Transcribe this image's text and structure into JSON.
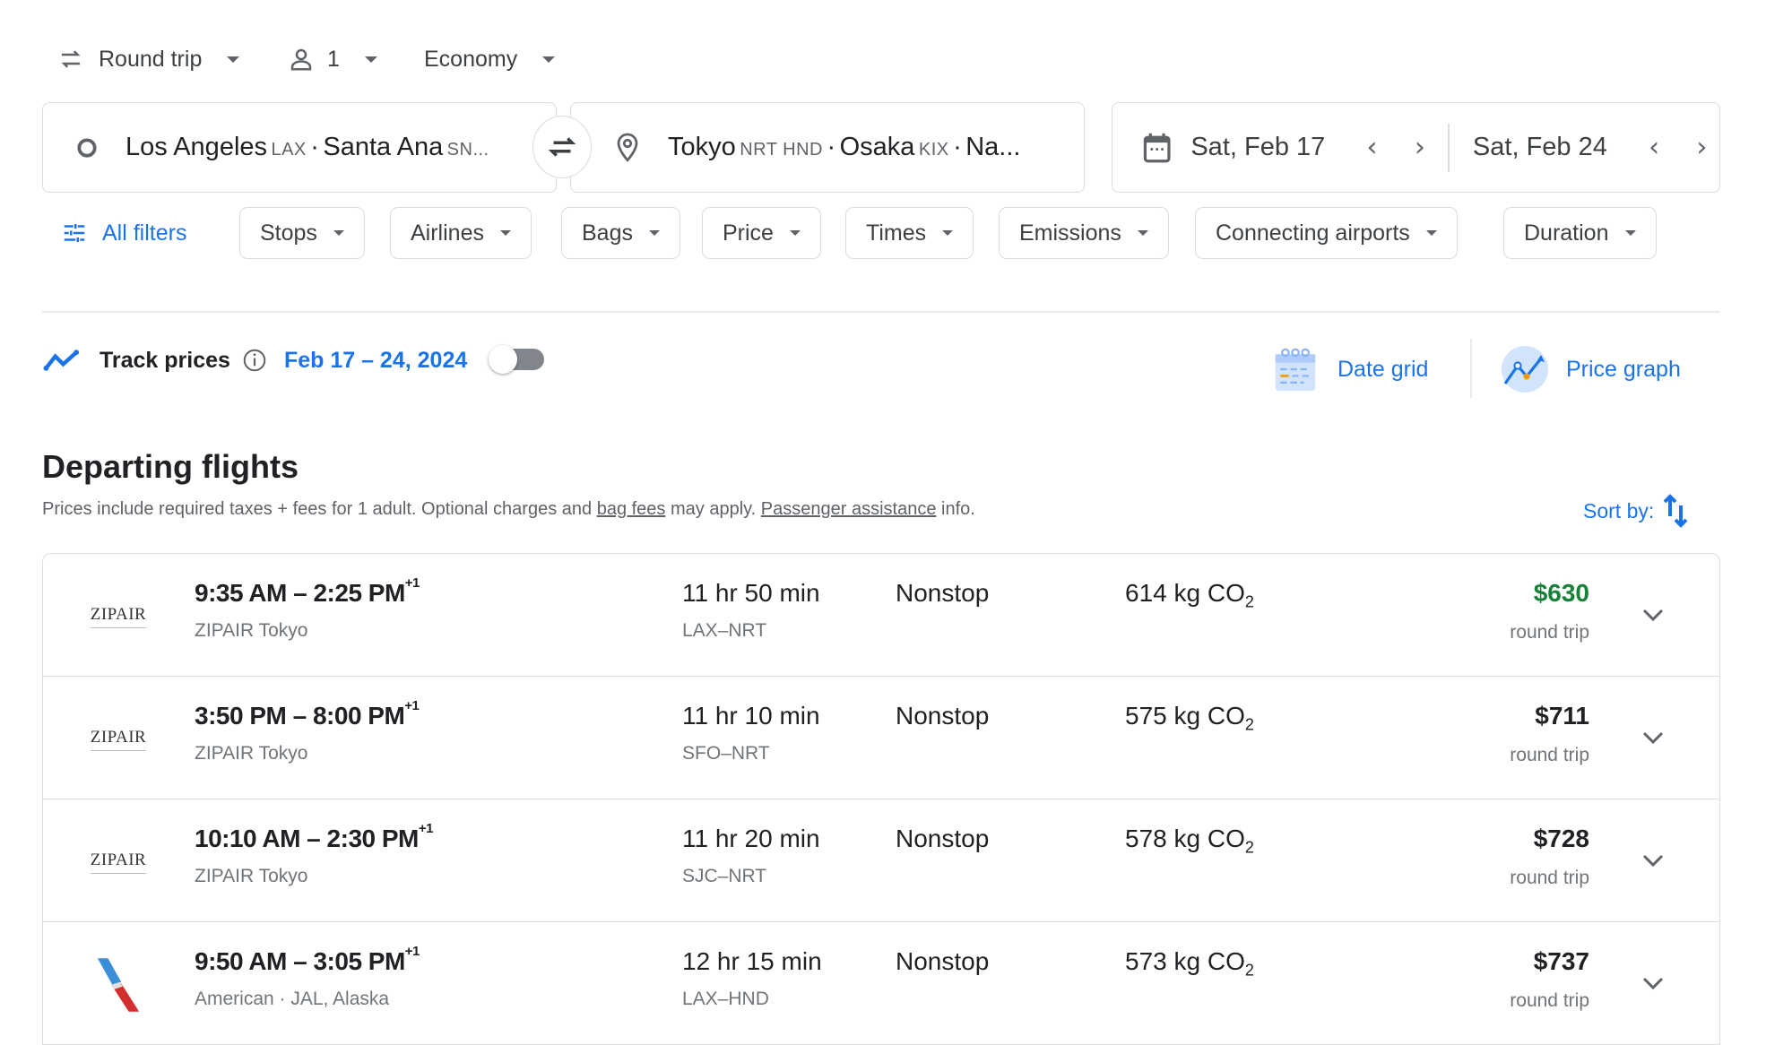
{
  "top_bar": {
    "trip_type": "Round trip",
    "passengers": "1",
    "cabin_class": "Economy"
  },
  "search": {
    "origin": {
      "city": "Los Angeles",
      "code": "LAX",
      "separator": "·",
      "city2": "Santa Ana",
      "code2": "SN..."
    },
    "destination": {
      "city": "Tokyo",
      "code": "NRT HND",
      "separator": "·",
      "city2": "Osaka",
      "code2": "KIX",
      "separator2": "·",
      "city3": "Na..."
    },
    "depart_date": "Sat, Feb 17",
    "return_date": "Sat, Feb 24"
  },
  "filters": {
    "all_filters": "All filters",
    "chips": [
      "Stops",
      "Airlines",
      "Bags",
      "Price",
      "Times",
      "Emissions",
      "Connecting airports",
      "Duration"
    ]
  },
  "track": {
    "label": "Track prices",
    "dates": "Feb 17 – 24, 2024",
    "toggle_on": false,
    "date_grid": "Date grid",
    "price_graph": "Price graph"
  },
  "section": {
    "title": "Departing flights",
    "note_pre": "Prices include required taxes + fees for 1 adult. Optional charges and ",
    "bag_fees_link": "bag fees",
    "note_mid": " may apply. ",
    "assistance_link": "Passenger assistance",
    "note_post": " info.",
    "sort_label": "Sort by:"
  },
  "colors": {
    "accent_blue": "#1a73e8",
    "cheapest_green": "#188038"
  },
  "flights": [
    {
      "logo": "ZIPAIR",
      "depart": "9:35 AM",
      "arrive": "2:25 PM",
      "day_offset": "+1",
      "airline": "ZIPAIR Tokyo",
      "duration": "11 hr 50 min",
      "route": "LAX–NRT",
      "stops": "Nonstop",
      "co2": "614 kg CO",
      "co2_sub": "2",
      "price": "$630",
      "price_type": "round trip",
      "cheapest": true
    },
    {
      "logo": "ZIPAIR",
      "depart": "3:50 PM",
      "arrive": "8:00 PM",
      "day_offset": "+1",
      "airline": "ZIPAIR Tokyo",
      "duration": "11 hr 10 min",
      "route": "SFO–NRT",
      "stops": "Nonstop",
      "co2": "575 kg CO",
      "co2_sub": "2",
      "price": "$711",
      "price_type": "round trip",
      "cheapest": false
    },
    {
      "logo": "ZIPAIR",
      "depart": "10:10 AM",
      "arrive": "2:30 PM",
      "day_offset": "+1",
      "airline": "ZIPAIR Tokyo",
      "duration": "11 hr 20 min",
      "route": "SJC–NRT",
      "stops": "Nonstop",
      "co2": "578 kg CO",
      "co2_sub": "2",
      "price": "$728",
      "price_type": "round trip",
      "cheapest": false
    },
    {
      "logo": "American",
      "depart": "9:50 AM",
      "arrive": "3:05 PM",
      "day_offset": "+1",
      "airline": "American · JAL, Alaska",
      "duration": "12 hr 15 min",
      "route": "LAX–HND",
      "stops": "Nonstop",
      "co2": "573 kg CO",
      "co2_sub": "2",
      "price": "$737",
      "price_type": "round trip",
      "cheapest": false
    }
  ]
}
